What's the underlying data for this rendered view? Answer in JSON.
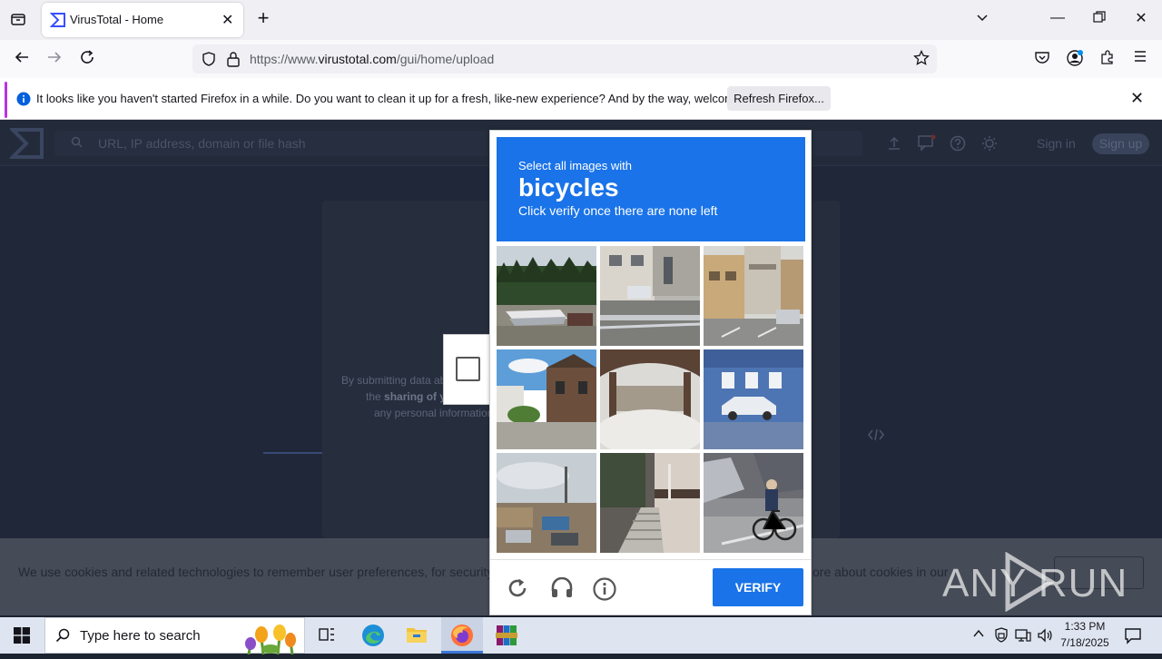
{
  "browser": {
    "tab_title": "VirusTotal - Home",
    "url_prefix": "https://www.",
    "url_domain": "virustotal.com",
    "url_path": "/gui/home/upload",
    "notice_text": "It looks like you haven't started Firefox in a while. Do you want to clean it up for a fresh, like-new experience? And by the way, welcome back!",
    "notice_button": "Refresh Firefox..."
  },
  "vt": {
    "search_placeholder": "URL, IP address, domain or file hash",
    "sign_in": "Sign in",
    "sign_up": "Sign up",
    "terms_line1": "By submitting data above,",
    "terms_line2_a": "the ",
    "terms_line2_b": "sharing of your Samp",
    "terms_line3": "any personal information",
    "cookie_text_left": "We use cookies and related technologies to remember user preferences, for security, to a",
    "cookie_text_right": "ore about cookies in our"
  },
  "captcha": {
    "intro": "Select all images with",
    "target": "bicycles",
    "instruction": "Click verify once there are none left",
    "verify_label": "VERIFY",
    "tiles": [
      "boats-forest",
      "street-houses",
      "street-buildings",
      "house-sky",
      "shelter-ground",
      "blue-building-car",
      "parking-lot",
      "stairs-building",
      "cyclist-street"
    ]
  },
  "taskbar": {
    "search_placeholder": "Type here to search",
    "time": "1:33 PM",
    "date": "7/18/2025"
  },
  "watermark": "ANY RUN",
  "colors": {
    "captcha_blue": "#1a73e8",
    "notice_accent": "#b933e1",
    "page_bg": "#202738"
  }
}
